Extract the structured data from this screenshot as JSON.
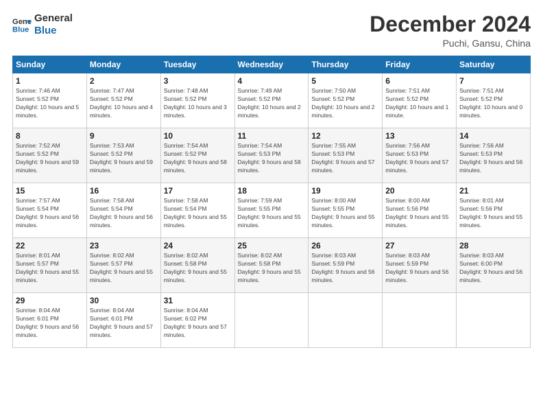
{
  "logo": {
    "line1": "General",
    "line2": "Blue"
  },
  "title": "December 2024",
  "location": "Puchi, Gansu, China",
  "days_of_week": [
    "Sunday",
    "Monday",
    "Tuesday",
    "Wednesday",
    "Thursday",
    "Friday",
    "Saturday"
  ],
  "weeks": [
    [
      {
        "day": "1",
        "sunrise": "Sunrise: 7:46 AM",
        "sunset": "Sunset: 5:52 PM",
        "daylight": "Daylight: 10 hours and 5 minutes."
      },
      {
        "day": "2",
        "sunrise": "Sunrise: 7:47 AM",
        "sunset": "Sunset: 5:52 PM",
        "daylight": "Daylight: 10 hours and 4 minutes."
      },
      {
        "day": "3",
        "sunrise": "Sunrise: 7:48 AM",
        "sunset": "Sunset: 5:52 PM",
        "daylight": "Daylight: 10 hours and 3 minutes."
      },
      {
        "day": "4",
        "sunrise": "Sunrise: 7:49 AM",
        "sunset": "Sunset: 5:52 PM",
        "daylight": "Daylight: 10 hours and 2 minutes."
      },
      {
        "day": "5",
        "sunrise": "Sunrise: 7:50 AM",
        "sunset": "Sunset: 5:52 PM",
        "daylight": "Daylight: 10 hours and 2 minutes."
      },
      {
        "day": "6",
        "sunrise": "Sunrise: 7:51 AM",
        "sunset": "Sunset: 5:52 PM",
        "daylight": "Daylight: 10 hours and 1 minute."
      },
      {
        "day": "7",
        "sunrise": "Sunrise: 7:51 AM",
        "sunset": "Sunset: 5:52 PM",
        "daylight": "Daylight: 10 hours and 0 minutes."
      }
    ],
    [
      {
        "day": "8",
        "sunrise": "Sunrise: 7:52 AM",
        "sunset": "Sunset: 5:52 PM",
        "daylight": "Daylight: 9 hours and 59 minutes."
      },
      {
        "day": "9",
        "sunrise": "Sunrise: 7:53 AM",
        "sunset": "Sunset: 5:52 PM",
        "daylight": "Daylight: 9 hours and 59 minutes."
      },
      {
        "day": "10",
        "sunrise": "Sunrise: 7:54 AM",
        "sunset": "Sunset: 5:52 PM",
        "daylight": "Daylight: 9 hours and 58 minutes."
      },
      {
        "day": "11",
        "sunrise": "Sunrise: 7:54 AM",
        "sunset": "Sunset: 5:53 PM",
        "daylight": "Daylight: 9 hours and 58 minutes."
      },
      {
        "day": "12",
        "sunrise": "Sunrise: 7:55 AM",
        "sunset": "Sunset: 5:53 PM",
        "daylight": "Daylight: 9 hours and 57 minutes."
      },
      {
        "day": "13",
        "sunrise": "Sunrise: 7:56 AM",
        "sunset": "Sunset: 5:53 PM",
        "daylight": "Daylight: 9 hours and 57 minutes."
      },
      {
        "day": "14",
        "sunrise": "Sunrise: 7:56 AM",
        "sunset": "Sunset: 5:53 PM",
        "daylight": "Daylight: 9 hours and 56 minutes."
      }
    ],
    [
      {
        "day": "15",
        "sunrise": "Sunrise: 7:57 AM",
        "sunset": "Sunset: 5:54 PM",
        "daylight": "Daylight: 9 hours and 56 minutes."
      },
      {
        "day": "16",
        "sunrise": "Sunrise: 7:58 AM",
        "sunset": "Sunset: 5:54 PM",
        "daylight": "Daylight: 9 hours and 56 minutes."
      },
      {
        "day": "17",
        "sunrise": "Sunrise: 7:58 AM",
        "sunset": "Sunset: 5:54 PM",
        "daylight": "Daylight: 9 hours and 55 minutes."
      },
      {
        "day": "18",
        "sunrise": "Sunrise: 7:59 AM",
        "sunset": "Sunset: 5:55 PM",
        "daylight": "Daylight: 9 hours and 55 minutes."
      },
      {
        "day": "19",
        "sunrise": "Sunrise: 8:00 AM",
        "sunset": "Sunset: 5:55 PM",
        "daylight": "Daylight: 9 hours and 55 minutes."
      },
      {
        "day": "20",
        "sunrise": "Sunrise: 8:00 AM",
        "sunset": "Sunset: 5:56 PM",
        "daylight": "Daylight: 9 hours and 55 minutes."
      },
      {
        "day": "21",
        "sunrise": "Sunrise: 8:01 AM",
        "sunset": "Sunset: 5:56 PM",
        "daylight": "Daylight: 9 hours and 55 minutes."
      }
    ],
    [
      {
        "day": "22",
        "sunrise": "Sunrise: 8:01 AM",
        "sunset": "Sunset: 5:57 PM",
        "daylight": "Daylight: 9 hours and 55 minutes."
      },
      {
        "day": "23",
        "sunrise": "Sunrise: 8:02 AM",
        "sunset": "Sunset: 5:57 PM",
        "daylight": "Daylight: 9 hours and 55 minutes."
      },
      {
        "day": "24",
        "sunrise": "Sunrise: 8:02 AM",
        "sunset": "Sunset: 5:58 PM",
        "daylight": "Daylight: 9 hours and 55 minutes."
      },
      {
        "day": "25",
        "sunrise": "Sunrise: 8:02 AM",
        "sunset": "Sunset: 5:58 PM",
        "daylight": "Daylight: 9 hours and 55 minutes."
      },
      {
        "day": "26",
        "sunrise": "Sunrise: 8:03 AM",
        "sunset": "Sunset: 5:59 PM",
        "daylight": "Daylight: 9 hours and 56 minutes."
      },
      {
        "day": "27",
        "sunrise": "Sunrise: 8:03 AM",
        "sunset": "Sunset: 5:59 PM",
        "daylight": "Daylight: 9 hours and 56 minutes."
      },
      {
        "day": "28",
        "sunrise": "Sunrise: 8:03 AM",
        "sunset": "Sunset: 6:00 PM",
        "daylight": "Daylight: 9 hours and 56 minutes."
      }
    ],
    [
      {
        "day": "29",
        "sunrise": "Sunrise: 8:04 AM",
        "sunset": "Sunset: 6:01 PM",
        "daylight": "Daylight: 9 hours and 56 minutes."
      },
      {
        "day": "30",
        "sunrise": "Sunrise: 8:04 AM",
        "sunset": "Sunset: 6:01 PM",
        "daylight": "Daylight: 9 hours and 57 minutes."
      },
      {
        "day": "31",
        "sunrise": "Sunrise: 8:04 AM",
        "sunset": "Sunset: 6:02 PM",
        "daylight": "Daylight: 9 hours and 57 minutes."
      },
      null,
      null,
      null,
      null
    ]
  ]
}
